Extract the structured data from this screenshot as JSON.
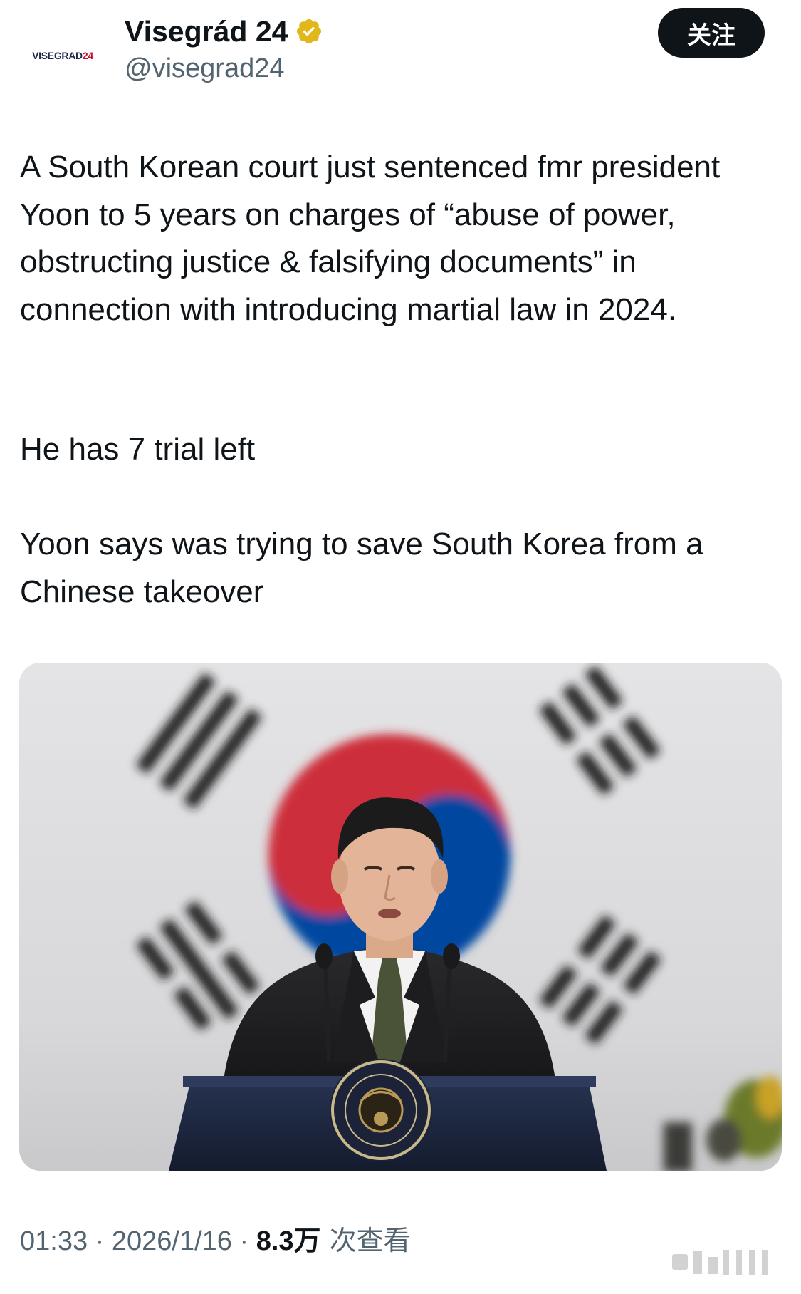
{
  "account": {
    "avatar_text": "VISEGRAD",
    "avatar_text_num": "24",
    "display_name": "Visegrád 24",
    "handle": "@visegrad24",
    "follow_label": "关注"
  },
  "tweet": {
    "paragraph_1": "A South Korean court just sentenced fmr president Yoon to 5 years on charges of “abuse of power, obstructing justice & falsifying documents” in connection with introducing martial law in 2024.",
    "paragraph_2": "He has 7 trial left",
    "paragraph_3": "Yoon says was trying to save South Korea from a Chinese takeover"
  },
  "meta": {
    "time": "01:33",
    "separator_1": " · ",
    "date": "2026/1/16",
    "separator_2": " · ",
    "views_count": "8.3万",
    "views_label": " 次查看"
  },
  "colors": {
    "text_primary": "#0f1419",
    "text_secondary": "#536471",
    "verified_badge": "#e2b719",
    "follow_bg": "#0f1419",
    "flag_red": "#cd2e3a",
    "flag_blue": "#0047a0"
  },
  "icons": {
    "verified": "verified-badge-icon"
  }
}
